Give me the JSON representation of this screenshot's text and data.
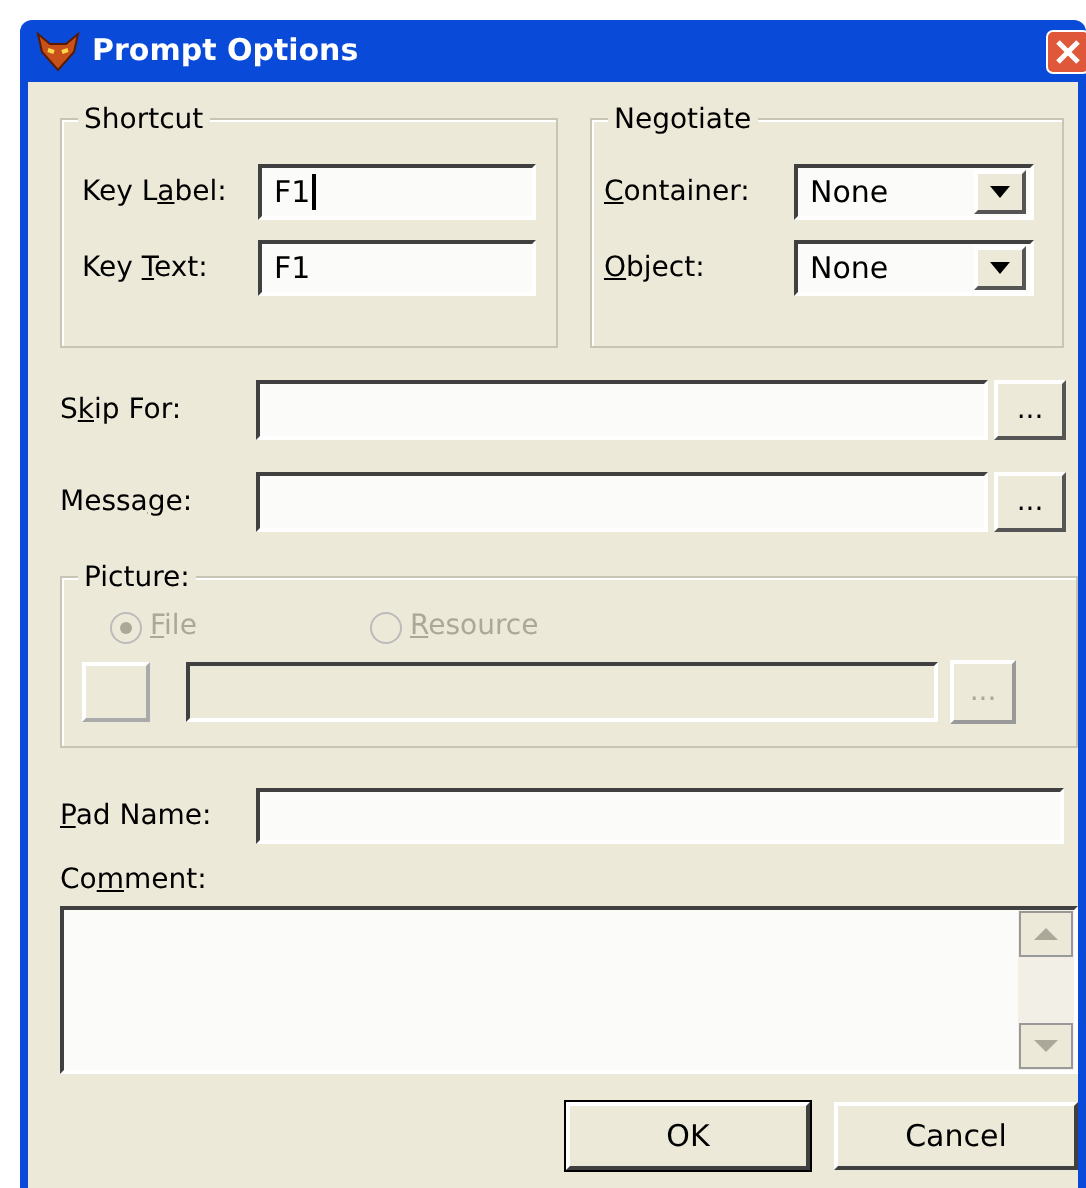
{
  "window": {
    "title": "Prompt Options"
  },
  "shortcut": {
    "title": "Shortcut",
    "fields": [
      {
        "label_before": "Key L",
        "mnemonic": "a",
        "label_after": "bel:",
        "value": "F1",
        "focused": true
      },
      {
        "label_before": "Key ",
        "mnemonic": "T",
        "label_after": "ext:",
        "value": "F1",
        "focused": false
      }
    ]
  },
  "negotiate": {
    "title": "Negotiate",
    "dropdowns": [
      {
        "mnemonic": "C",
        "label_after": "ontainer:",
        "value": "None"
      },
      {
        "mnemonic": "O",
        "label_after": "bject:",
        "value": "None"
      }
    ]
  },
  "rows": [
    {
      "label_before": "S",
      "mnemonic": "k",
      "label_after": "ip For:",
      "button": "..."
    },
    {
      "label_before": "Messa",
      "mnemonic": "g",
      "label_after": "e:",
      "button": "..."
    }
  ],
  "picture": {
    "title": "Picture:",
    "disabled": true,
    "options": [
      {
        "mnemonic": "F",
        "label_after": "ile",
        "selected": true
      },
      {
        "mnemonic": "R",
        "label_after": "esource",
        "selected": false
      }
    ],
    "button": "..."
  },
  "pad_name": {
    "mnemonic": "P",
    "label_after": "ad Name:"
  },
  "comment": {
    "label_before": "Co",
    "mnemonic": "m",
    "label_after": "ment:"
  },
  "buttons": [
    {
      "label": "OK",
      "default": true
    },
    {
      "label": "Cancel",
      "default": false
    }
  ]
}
